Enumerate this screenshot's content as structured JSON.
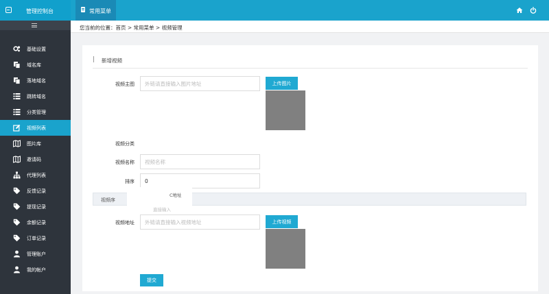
{
  "header": {
    "brand": "管理控制台",
    "menu_tab": "常用菜单",
    "icons": [
      "home-icon",
      "power-icon"
    ],
    "accent_color": "#1aa3cc"
  },
  "sidebar": {
    "collapse_icon": "menu-toggle-icon",
    "items": [
      {
        "label": "基础设置",
        "icon": "gears-icon"
      },
      {
        "label": "域名库",
        "icon": "copy-icon"
      },
      {
        "label": "落地域名",
        "icon": "copy-icon"
      },
      {
        "label": "跳转域名",
        "icon": "list-icon"
      },
      {
        "label": "分类管理",
        "icon": "list-icon"
      },
      {
        "label": "视频列表",
        "icon": "edit-icon",
        "active": true
      },
      {
        "label": "图片库",
        "icon": "map-icon"
      },
      {
        "label": "邀请码",
        "icon": "map-icon"
      },
      {
        "label": "代理列表",
        "icon": "sitemap-icon"
      },
      {
        "label": "反馈记录",
        "icon": "tag-icon"
      },
      {
        "label": "提现记录",
        "icon": "tag-icon"
      },
      {
        "label": "余额记录",
        "icon": "tag-icon"
      },
      {
        "label": "订单记录",
        "icon": "tag-icon"
      },
      {
        "label": "管理账户",
        "icon": "user-icon"
      },
      {
        "label": "我的帐户",
        "icon": "user-icon"
      }
    ]
  },
  "breadcrumb": "您当前的位置：首页 > 常用菜单 > 视频管理",
  "form": {
    "title": "新增视频",
    "cover_label": "视频主图",
    "cover_placeholder": "外链请直接输入图片地址",
    "upload_image_button": "上传图片",
    "category_label": "视频分类",
    "name_label": "视频名称",
    "name_placeholder": "视频名称",
    "sort_label": "排序",
    "sort_value": "0",
    "overlay_label": "视频序",
    "overlay_text1": "C地址",
    "overlay_text2": "直接输入",
    "video_url_label": "视频地址",
    "video_url_placeholder": "外链请直接输入视频地址",
    "upload_video_button": "上传视频",
    "submit_button": "提交"
  }
}
